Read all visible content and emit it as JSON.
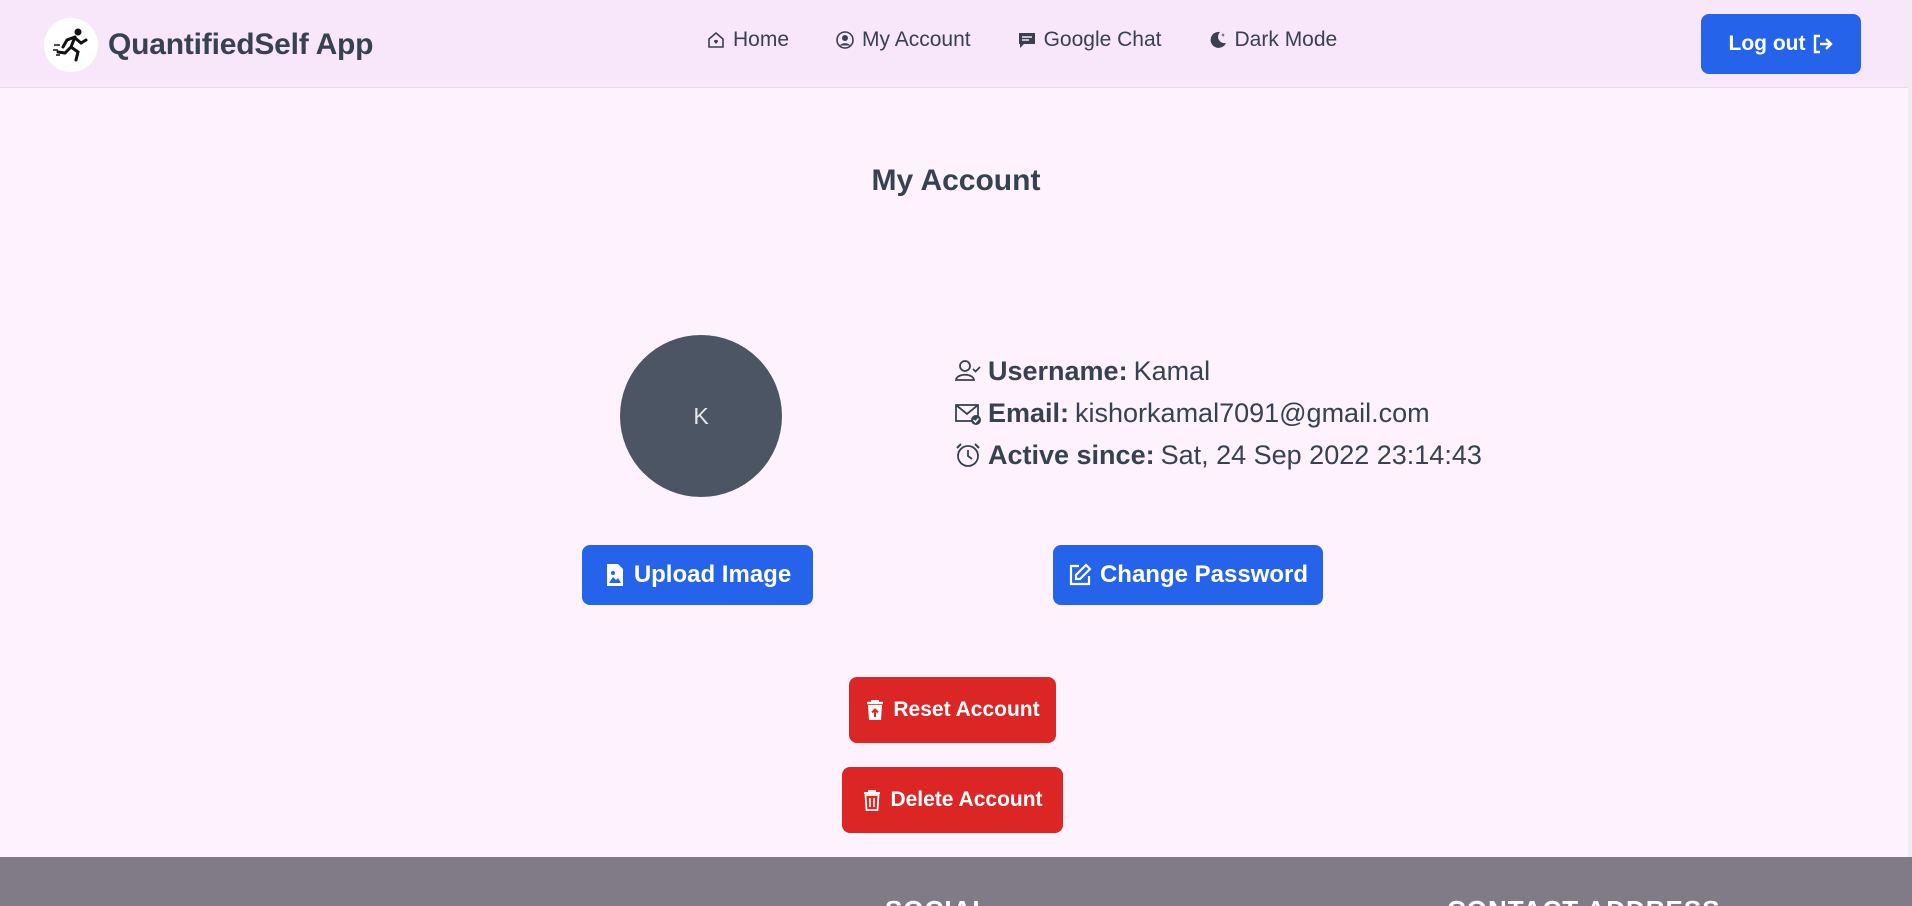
{
  "app": {
    "title": "QuantifiedSelf App"
  },
  "nav": {
    "items": [
      {
        "label": "Home",
        "icon": "home-icon"
      },
      {
        "label": "My Account",
        "icon": "user-circle-icon"
      },
      {
        "label": "Google Chat",
        "icon": "chat-icon"
      },
      {
        "label": "Dark Mode",
        "icon": "moon-icon"
      }
    ],
    "logout_label": "Log out"
  },
  "page": {
    "title": "My Account"
  },
  "profile": {
    "avatar_initial": "K",
    "username_label": "Username:",
    "username": "Kamal",
    "email_label": "Email:",
    "email": "kishorkamal7091@gmail.com",
    "active_label": "Active since:",
    "active_since": "Sat, 24 Sep 2022 23:14:43"
  },
  "actions": {
    "upload_label": "Upload Image",
    "change_password_label": "Change Password",
    "reset_label": "Reset Account",
    "delete_label": "Delete Account"
  },
  "footer": {
    "social_heading": "SOCIAL",
    "contact_heading": "CONTACT ADDRESS"
  },
  "colors": {
    "primary": "#2563eb",
    "danger": "#dc2626",
    "navbar": "#f8e6fa",
    "footer": "#817b87"
  }
}
